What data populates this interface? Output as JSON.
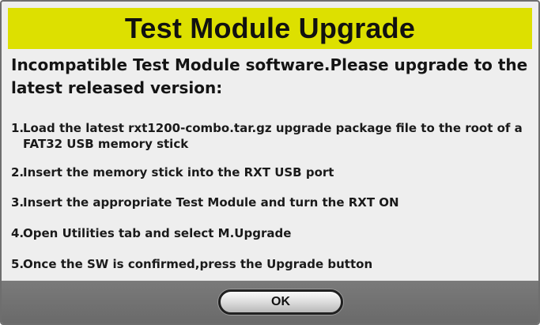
{
  "dialog": {
    "title": "Test Module Upgrade",
    "headline": "Incompatible Test Module software.Please upgrade to the latest released version:",
    "steps": [
      {
        "num": "1.",
        "text": "Load the latest rxt1200-combo.tar.gz upgrade package file to the root of a FAT32 USB memory stick"
      },
      {
        "num": "2.",
        "text": "Insert the memory stick into the RXT USB port"
      },
      {
        "num": "3.",
        "text": "Insert the appropriate Test Module and turn the RXT ON"
      },
      {
        "num": "4.",
        "text": "Open Utilities tab and select M.Upgrade"
      },
      {
        "num": "5.",
        "text": "Once the SW is confirmed,press the Upgrade button"
      }
    ],
    "ok_label": "OK"
  },
  "colors": {
    "title_bar": "#dde000",
    "body_background": "#eeeeee",
    "footer_background": "#707070"
  }
}
